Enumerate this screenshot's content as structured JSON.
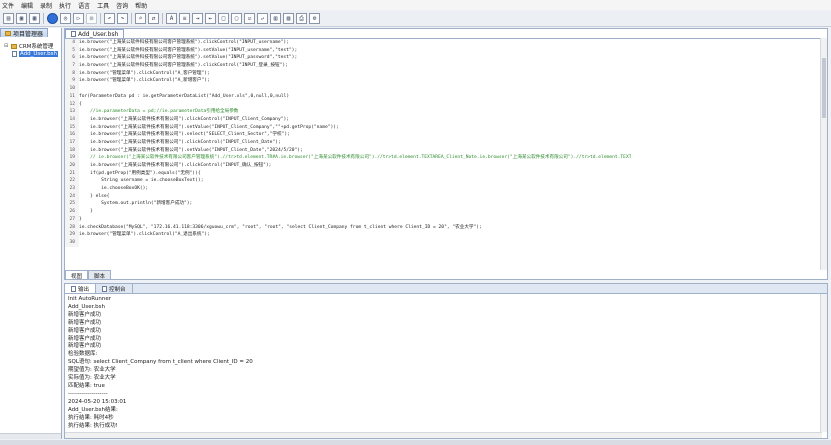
{
  "menu": [
    "文件",
    "编辑",
    "录制",
    "执行",
    "语言",
    "工具",
    "咨询",
    "帮助"
  ],
  "toolbar": {
    "buttons": [
      "new-file",
      "save",
      "save-all",
      "record",
      "run",
      "pause",
      "stop",
      "undo",
      "redo",
      "find",
      "replace",
      "font",
      "align",
      "indent",
      "outdent",
      "comment",
      "uncomment",
      "check",
      "wrap",
      "format",
      "preview",
      "print",
      "settings"
    ]
  },
  "project": {
    "tab_label": "项目管理器",
    "root": "CRM系统管理",
    "child": "Add_User.bsh"
  },
  "editor": {
    "tab_label": "Add_User.bsh",
    "lines": [
      {
        "n": "4",
        "t": "ie.browser(\"上海某公软件科技有限公司客户管理系统\").clickControl(\"INPUT_username\");"
      },
      {
        "n": "5",
        "t": "ie.browser(\"上海某公软件科技有限公司客户管理系统\").setValue(\"INPUT_username\",\"test\");"
      },
      {
        "n": "6",
        "t": "ie.browser(\"上海某公软件科技有限公司客户管理系统\").setValue(\"INPUT_password\",\"test\");"
      },
      {
        "n": "7",
        "t": "ie.browser(\"上海某公软件科技有限公司客户管理系统\").clickControl(\"INPUT_登录_按钮\");"
      },
      {
        "n": "8",
        "t": "ie.browser(\"管理菜单\").clickControl(\"A_客户管理\");"
      },
      {
        "n": "9",
        "t": "ie.browser(\"管理菜单\").clickControl(\"A_新增客户\");"
      },
      {
        "n": "10",
        "t": ""
      },
      {
        "n": "11",
        "t": "for(ParameterData pd : ie.getParameterDataList(\"Add_User.xls\",0,null,0,null)"
      },
      {
        "n": "12",
        "t": "{"
      },
      {
        "n": "13",
        "t": "    //ie.parameterData = pd;//ie.parameterData引用给全局参数"
      },
      {
        "n": "14",
        "t": "    ie.browser(\"上海某公软件技术有限公司\").clickControl(\"INPUT_Client_Company\");"
      },
      {
        "n": "15",
        "t": "    ie.browser(\"上海某公软件技术有限公司\").setValue(\"INPUT_Client_Company\",\"\"+pd.getProp(\"name\"));"
      },
      {
        "n": "16",
        "t": "    ie.browser(\"上海某公软件技术有限公司\").select(\"SELECT_Client_Sector\",\"学校\");"
      },
      {
        "n": "17",
        "t": "    ie.browser(\"上海某公软件技术有限公司\").clickControl(\"INPUT_Client_Date\");"
      },
      {
        "n": "18",
        "t": "    ie.browser(\"上海某公软件技术有限公司\").setValue(\"INPUT_Client_Date\",\"2024/5/20\");"
      },
      {
        "n": "19",
        "t": "    // ie.browser(\"上海某公软件技术有限公司客户管理系统\").//tr>td.element.TR#A.ie.browser(\"上海某公软件技术有限公司\").//tr>td.element.TEXTAREA_Client_Note.ie.browser(\"上海某公软件技术有限公司\").//tr>td.element.TEXT"
      },
      {
        "n": "20",
        "t": "    ie.browser(\"上海某公软件技术有限公司\").clickControl(\"INPUT_确认_按钮\");"
      },
      {
        "n": "21",
        "t": "    if(pd.getProp(\"用例类型\").equals(\"无例\")){"
      },
      {
        "n": "22",
        "t": "        String username = ie.chooseBoxText();"
      },
      {
        "n": "23",
        "t": "        ie.chooseBoxOK();"
      },
      {
        "n": "24",
        "t": "    } else{"
      },
      {
        "n": "25",
        "t": "        System.out.println(\"新增客户成功\");"
      },
      {
        "n": "26",
        "t": "    }"
      },
      {
        "n": "27",
        "t": "}"
      },
      {
        "n": "28",
        "t": "ie.checkDatabase(\"MySQL\", \"172.16.41.118:3306/xguowu_crm\", \"root\", \"root\", \"select Client_Company from t_client where Client_ID = 20\", \"农业大学\");"
      },
      {
        "n": "29",
        "t": "ie.browser(\"管理菜单\").clickControl(\"A_退出系统\");"
      },
      {
        "n": "30",
        "t": ""
      }
    ],
    "subtabs": [
      "视图",
      "脚本"
    ]
  },
  "output": {
    "tabs": [
      "输出",
      "控制台"
    ],
    "lines": [
      "Init AutoRunner",
      "Add_User.bsh",
      "新增客户成功",
      "新增客户成功",
      "新增客户成功",
      "新增客户成功",
      "新增客户成功",
      "检验数据库:",
      "SQL语句: select Client_Company from t_client where Client_ID = 20",
      "期望值为: 农业大学",
      "实际值为: 农业大学",
      "匹配结果: true",
      "--------------------",
      "2024-05-20 15:03:01",
      "Add_User.bsh结果:",
      "执行结果: 耗时4秒",
      "执行结果: 执行成功!"
    ]
  },
  "colors": {
    "accent": "#2f6fd6",
    "selection": "#3a78d8",
    "string": "#8b0000",
    "comment": "#2b8a2b"
  }
}
